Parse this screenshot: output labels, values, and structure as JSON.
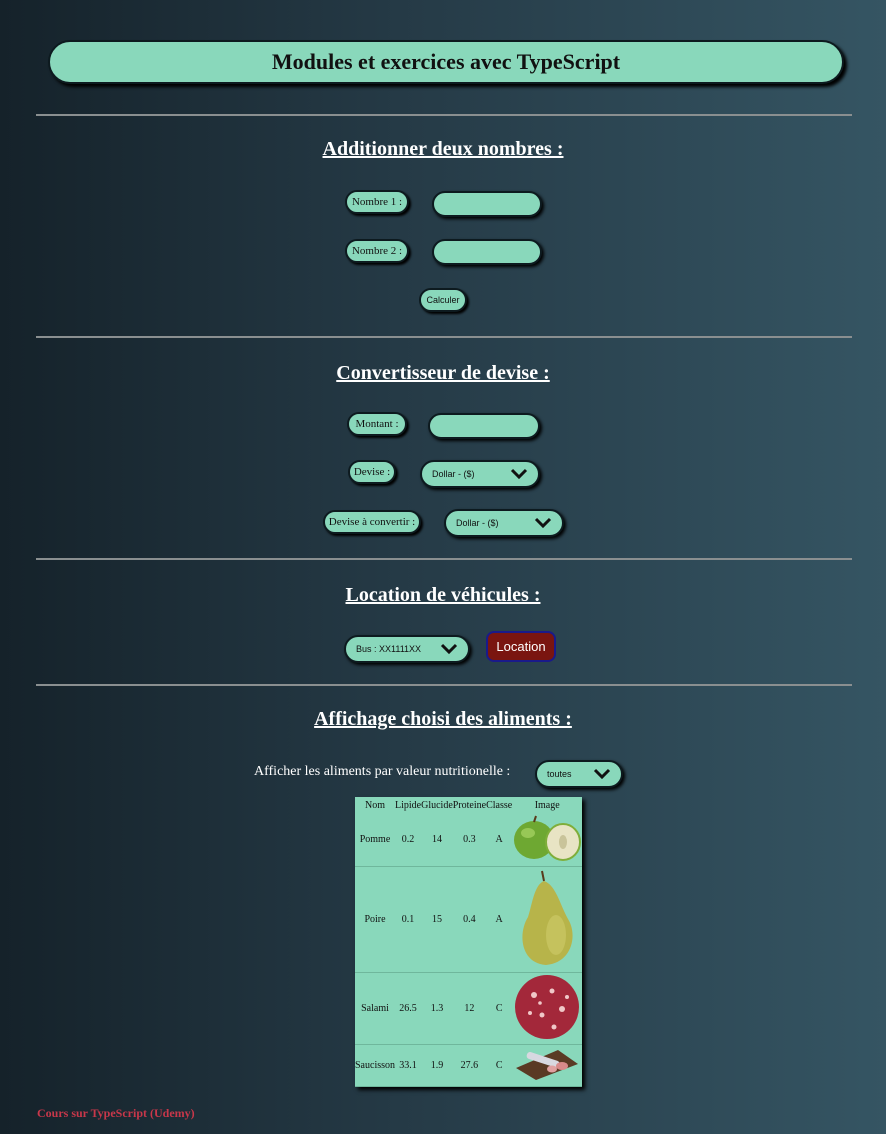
{
  "header": {
    "title": "Modules et exercices avec TypeScript"
  },
  "addition": {
    "title": "Additionner deux nombres :",
    "label1": "Nombre 1 :",
    "label2": "Nombre 2 :",
    "value1": "",
    "value2": "",
    "button": "Calculer"
  },
  "converter": {
    "title": "Convertisseur de devise :",
    "amount_label": "Montant :",
    "amount_value": "",
    "currency_label": "Devise :",
    "currency_selected": "Dollar - ($)",
    "target_label": "Devise à convertir :",
    "target_selected": "Dollar - ($)"
  },
  "rental": {
    "title": "Location de véhicules :",
    "vehicle_selected": "Bus : XX1111XX",
    "button": "Location"
  },
  "foods": {
    "title": "Affichage choisi des aliments :",
    "filter_label": "Afficher les aliments par valeur nutritionelle :",
    "filter_selected": "toutes",
    "columns": [
      "Nom",
      "Lipide",
      "Glucide",
      "Proteine",
      "Classe",
      "Image"
    ],
    "rows": [
      {
        "name": "Pomme",
        "lipide": "0.2",
        "glucide": "14",
        "proteine": "0.3",
        "classe": "A",
        "image": "apple-image"
      },
      {
        "name": "Poire",
        "lipide": "0.1",
        "glucide": "15",
        "proteine": "0.4",
        "classe": "A",
        "image": "pear-image"
      },
      {
        "name": "Salami",
        "lipide": "26.5",
        "glucide": "1.3",
        "proteine": "12",
        "classe": "C",
        "image": "salami-image"
      },
      {
        "name": "Saucisson",
        "lipide": "33.1",
        "glucide": "1.9",
        "proteine": "27.6",
        "classe": "C",
        "image": "saucisson-image"
      }
    ]
  },
  "footer": {
    "text": "Cours sur TypeScript (Udemy)"
  },
  "colors": {
    "mint": "#89d8bb",
    "location_button": "#7a1510",
    "footer": "#c8374a"
  }
}
